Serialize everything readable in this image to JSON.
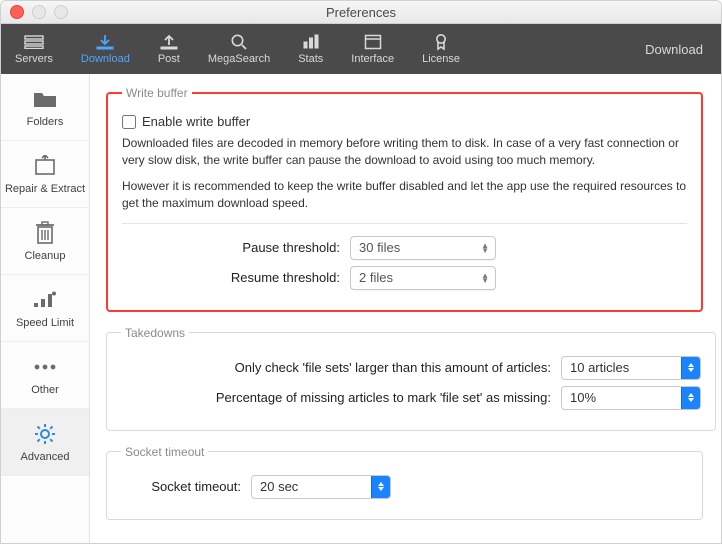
{
  "window": {
    "title": "Preferences"
  },
  "toolbar": {
    "items": [
      {
        "label": "Servers"
      },
      {
        "label": "Download"
      },
      {
        "label": "Post"
      },
      {
        "label": "MegaSearch"
      },
      {
        "label": "Stats"
      },
      {
        "label": "Interface"
      },
      {
        "label": "License"
      }
    ],
    "active_index": 1,
    "right_label": "Download"
  },
  "sidebar": {
    "items": [
      {
        "label": "Folders"
      },
      {
        "label": "Repair & Extract"
      },
      {
        "label": "Cleanup"
      },
      {
        "label": "Speed Limit"
      },
      {
        "label": "Other"
      },
      {
        "label": "Advanced"
      }
    ],
    "selected_index": 5
  },
  "write_buffer": {
    "legend": "Write buffer",
    "checkbox_label": "Enable write buffer",
    "desc1": "Downloaded files are decoded in memory before writing them to disk. In case of a very fast connection or very slow disk, the write buffer can pause the download to avoid using too much memory.",
    "desc2": "However it is recommended to keep the write buffer disabled and let the app use the required resources to get the maximum download speed.",
    "pause_label": "Pause threshold:",
    "pause_value": "30 files",
    "resume_label": "Resume threshold:",
    "resume_value": "2 files"
  },
  "takedowns": {
    "legend": "Takedowns",
    "row1_label": "Only check 'file sets' larger than this amount of articles:",
    "row1_value": "10 articles",
    "row2_label": "Percentage of missing articles to mark 'file set' as missing:",
    "row2_value": "10%"
  },
  "socket": {
    "legend": "Socket timeout",
    "label": "Socket timeout:",
    "value": "20 sec"
  }
}
